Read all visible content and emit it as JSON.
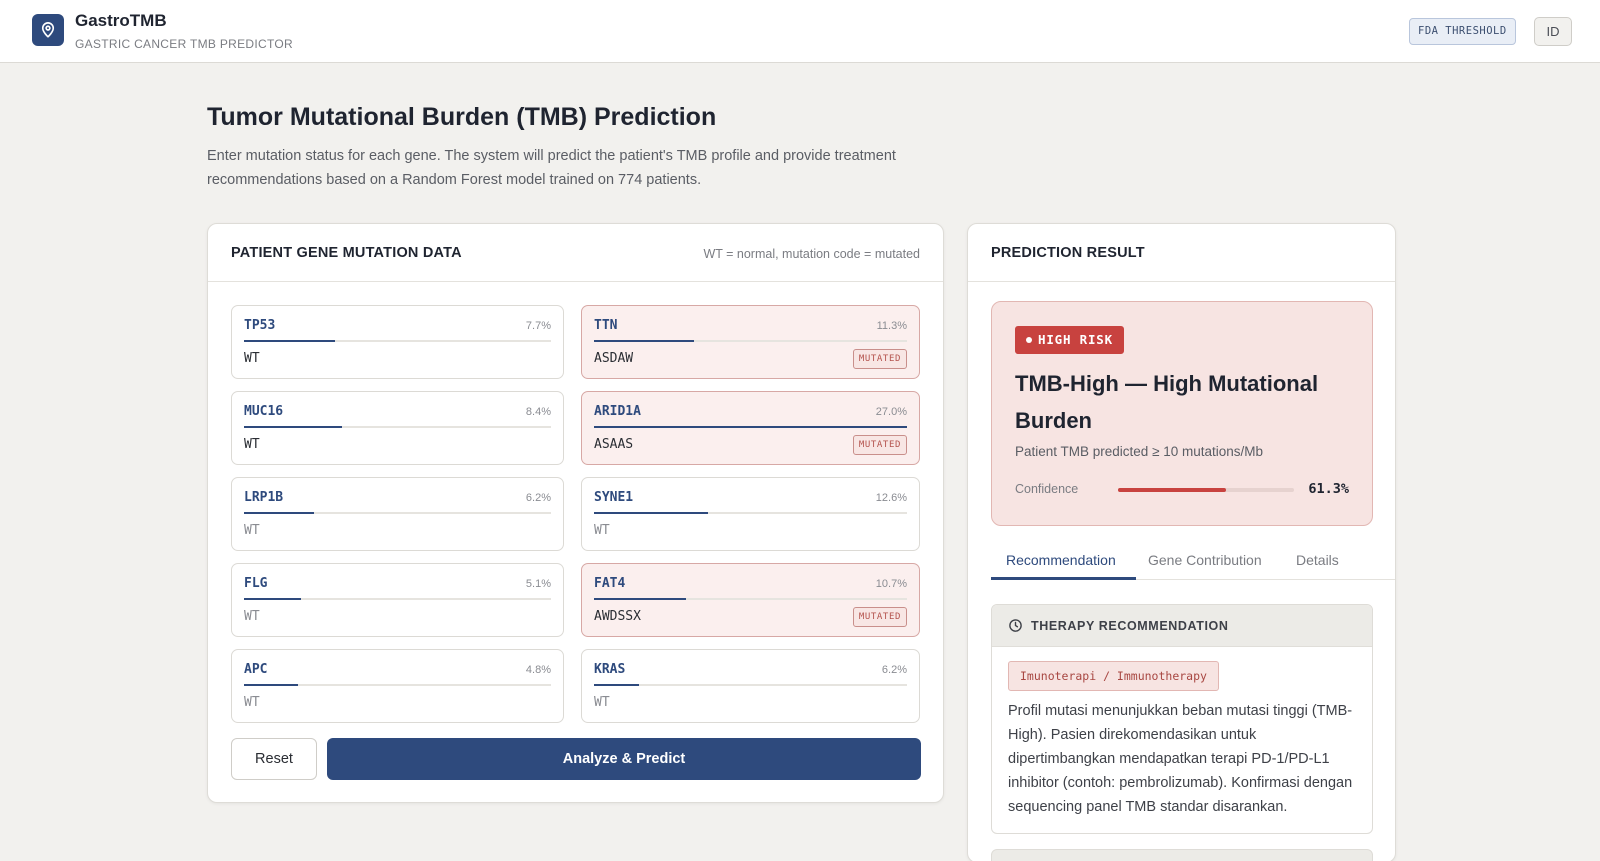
{
  "app": {
    "name": "GastroTMB",
    "subtitle": "GASTRIC CANCER TMB PREDICTOR",
    "fda_badge": "FDA THRESHOLD",
    "lang_button": "ID"
  },
  "page": {
    "title": "Tumor Mutational Burden (TMB) Prediction",
    "description": "Enter mutation status for each gene. The system will predict the patient's TMB profile and provide treatment recommendations based on a Random Forest model trained on 774 patients."
  },
  "gene_panel": {
    "title": "PATIENT GENE MUTATION DATA",
    "legend": "WT = normal, mutation code = mutated",
    "mutated_label": "MUTATED",
    "genes": [
      {
        "name": "TP53",
        "pct": "7.7%",
        "fill": 0.297,
        "value": "WT",
        "mutated": false,
        "dim": false
      },
      {
        "name": "TTN",
        "pct": "11.3%",
        "fill": 0.321,
        "value": "ASDAW",
        "mutated": true,
        "dim": false
      },
      {
        "name": "MUC16",
        "pct": "8.4%",
        "fill": 0.318,
        "value": "WT",
        "mutated": false,
        "dim": false
      },
      {
        "name": "ARID1A",
        "pct": "27.0%",
        "fill": 1.0,
        "value": "ASAAS",
        "mutated": true,
        "dim": false
      },
      {
        "name": "LRP1B",
        "pct": "6.2%",
        "fill": 0.229,
        "value": "WT",
        "mutated": false,
        "dim": true
      },
      {
        "name": "SYNE1",
        "pct": "12.6%",
        "fill": 0.363,
        "value": "WT",
        "mutated": false,
        "dim": true
      },
      {
        "name": "FLG",
        "pct": "5.1%",
        "fill": 0.187,
        "value": "WT",
        "mutated": false,
        "dim": true
      },
      {
        "name": "FAT4",
        "pct": "10.7%",
        "fill": 0.294,
        "value": "AWDSSX",
        "mutated": true,
        "dim": false
      },
      {
        "name": "APC",
        "pct": "4.8%",
        "fill": 0.176,
        "value": "WT",
        "mutated": false,
        "dim": true
      },
      {
        "name": "KRAS",
        "pct": "6.2%",
        "fill": 0.144,
        "value": "WT",
        "mutated": false,
        "dim": true
      }
    ],
    "reset_label": "Reset",
    "predict_label": "Analyze & Predict"
  },
  "result": {
    "title": "PREDICTION RESULT",
    "risk_badge": "HIGH RISK",
    "risk_title": "TMB-High — High Mutational Burden",
    "risk_subtitle": "Patient TMB predicted ≥ 10 mutations/Mb",
    "confidence_label": "Confidence",
    "confidence_value": "61.3%",
    "confidence_fraction": 0.613,
    "tabs": [
      "Recommendation",
      "Gene Contribution",
      "Details"
    ],
    "therapy": {
      "title": "THERAPY RECOMMENDATION",
      "tag": "Imunoterapi / Immunotherapy",
      "text": "Profil mutasi menunjukkan beban mutasi tinggi (TMB-High). Pasien direkomendasikan untuk dipertimbangkan mendapatkan terapi PD-1/PD-L1 inhibitor (contoh: pembrolizumab). Konfirmasi dengan sequencing panel TMB standar disarankan."
    }
  },
  "colors": {
    "primary": "#2e4a7d",
    "danger": "#c8423f",
    "danger_bg": "#f7e4e2",
    "page_bg": "#f2f1ee"
  },
  "icons": {
    "logo": "location-pin-icon",
    "therapy": "clock-icon"
  }
}
